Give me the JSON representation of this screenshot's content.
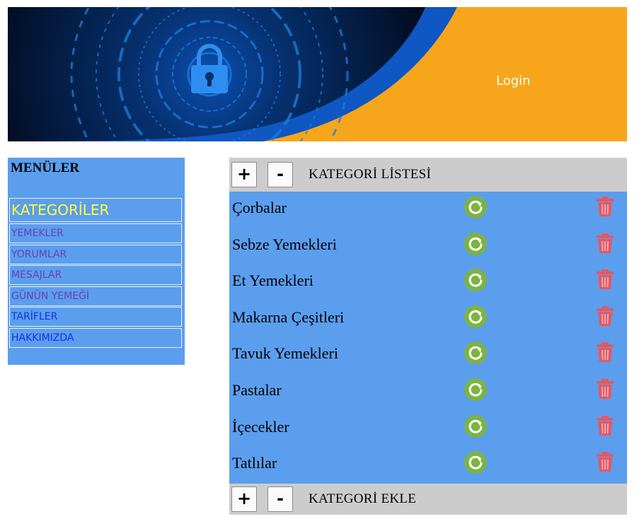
{
  "banner": {
    "login_label": "Login",
    "colors": {
      "dark": "#031a3a",
      "blue": "#0f57c2",
      "orange": "#f7a61b"
    },
    "icon": "lock-icon"
  },
  "menu": {
    "title": "MENÜLER",
    "items": [
      {
        "label": "KATEGORİLER",
        "style": "active"
      },
      {
        "label": "YEMEKLER",
        "style": "purple"
      },
      {
        "label": "YORUMLAR",
        "style": "purple"
      },
      {
        "label": "MESAJLAR",
        "style": "purple"
      },
      {
        "label": "GÜNÜN YEMEĞİ",
        "style": "purple"
      },
      {
        "label": "TARİFLER",
        "style": "blue"
      },
      {
        "label": "HAKKIMIZDA",
        "style": "blue"
      }
    ],
    "colors": {
      "background": "#5b9eee",
      "active": "#ffff3b",
      "visited": "#6a3fb5",
      "link": "#1530e8"
    }
  },
  "list_panel": {
    "plus_label": "+",
    "minus_label": "-",
    "title": "KATEGORİ LİSTESİ",
    "categories": [
      "Çorbalar",
      "Sebze Yemekleri",
      "Et Yemekleri",
      "Makarna Çeşitleri",
      "Tavuk Yemekleri",
      "Pastalar",
      "İçecekler",
      "Tatlılar"
    ],
    "row_icons": [
      "refresh-icon",
      "trash-icon"
    ]
  },
  "add_panel": {
    "plus_label": "+",
    "minus_label": "-",
    "title": "KATEGORİ EKLE"
  }
}
